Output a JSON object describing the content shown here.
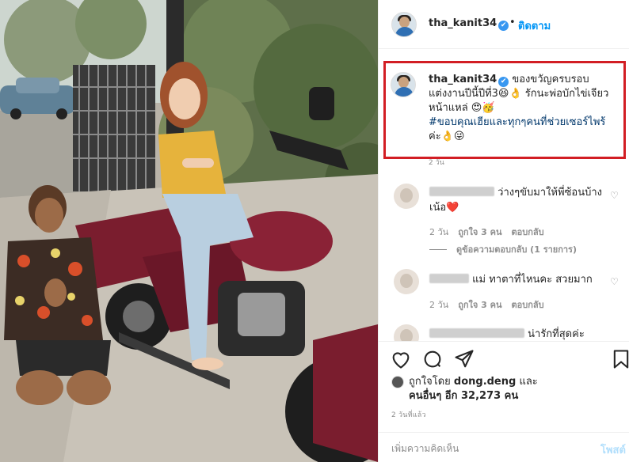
{
  "post": {
    "username": "tha_kanit34",
    "verified_mark": "✔",
    "dot": "•",
    "follow_label": "ติดตาม"
  },
  "caption": {
    "username": "tha_kanit34",
    "text": "ของขวัญครบรอบแต่งงานปีนี้ปีที่3😆👌 รักนะพ่อบักไข่เจียวหน้าแหล่ 😍🥳",
    "hashtag": "#ขอบคุณเฮียและทุกๆคนที่ช่วยเซอร์ไพร้",
    "suffix": "ค่ะ👌😜",
    "time": "2 วัน"
  },
  "comments": [
    {
      "text": "ว่างๆขับมาให้พี่ซ้อนบ้างเน้อ❤️",
      "time": "2 วัน",
      "likes": "ถูกใจ 3 คน",
      "reply": "ตอบกลับ",
      "view_replies": "ดูข้อความตอบกลับ (1 รายการ)"
    },
    {
      "text": "แม่ ทาตาที่ไหนคะ สวยมาก",
      "time": "2 วัน",
      "likes": "ถูกใจ 3 คน",
      "reply": "ตอบกลับ"
    },
    {
      "text": "น่ารักที่สุดค่ะ"
    }
  ],
  "icons": {
    "like": "heart-icon",
    "comment": "comment-icon",
    "share": "share-icon",
    "save": "bookmark-icon",
    "small_like": "heart-outline-icon"
  },
  "likes": {
    "prefix": "ถูกใจโดย",
    "first_user": "dong.deng",
    "and": "และ",
    "others": "คนอื่นๆ อีก 32,273 คน"
  },
  "posted_time": "2 วันที่แล้ว",
  "add_comment": {
    "placeholder": "เพิ่มความคิดเห็น",
    "post_label": "โพสต์"
  },
  "colors": {
    "highlight_border": "#d21e24",
    "link_blue": "#0095f6",
    "hashtag": "#00376b",
    "motorcycle": "#7a1d2e"
  }
}
